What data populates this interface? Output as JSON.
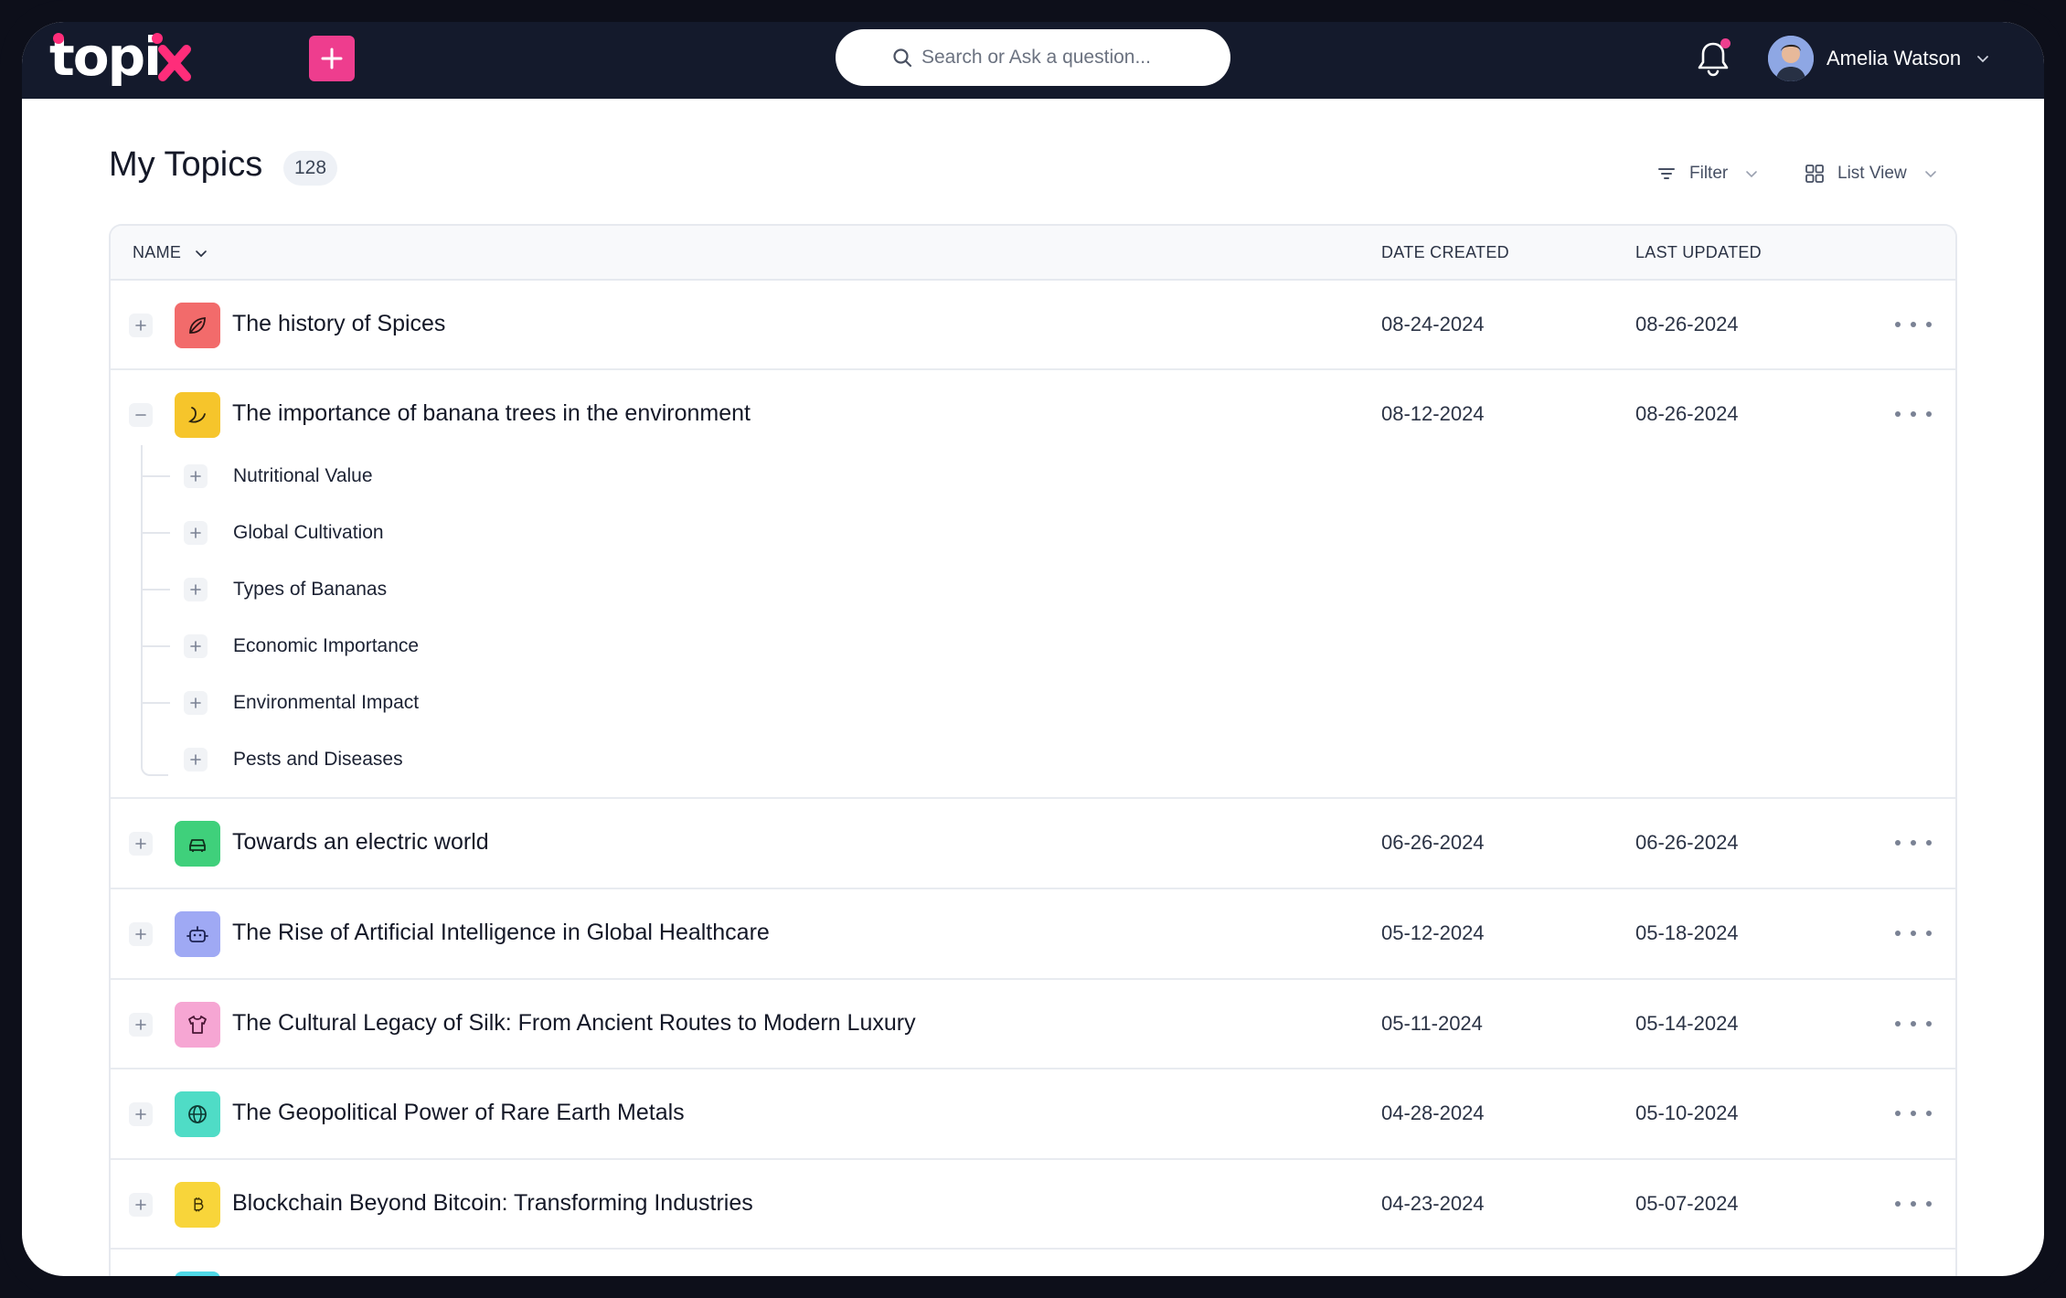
{
  "app": {
    "logo": "topix",
    "add_button_label": "+",
    "search_placeholder": "Search or Ask a question...",
    "user_name": "Amelia Watson"
  },
  "page": {
    "title": "My Topics",
    "count": "128",
    "filter_label": "Filter",
    "view_label": "List View"
  },
  "table": {
    "headers": {
      "name": "NAME",
      "created": "DATE CREATED",
      "updated": "LAST UPDATED"
    },
    "rows": [
      {
        "name": "The history of Spices",
        "created": "08-24-2024",
        "updated": "08-26-2024",
        "icon": "leaf-icon",
        "color": "#f26b6b",
        "expanded": false
      },
      {
        "name": "The importance of banana trees in the environment",
        "created": "08-12-2024",
        "updated": "08-26-2024",
        "icon": "banana-icon",
        "color": "#f6c52b",
        "expanded": true,
        "subtopics": [
          "Nutritional Value",
          "Global Cultivation",
          "Types of Bananas",
          "Economic Importance",
          "Environmental Impact",
          "Pests and Diseases"
        ]
      },
      {
        "name": "Towards an electric world",
        "created": "06-26-2024",
        "updated": "06-26-2024",
        "icon": "car-icon",
        "color": "#3fd07b",
        "expanded": false
      },
      {
        "name": "The Rise of Artificial Intelligence in Global Healthcare",
        "created": "05-12-2024",
        "updated": "05-18-2024",
        "icon": "robot-icon",
        "color": "#9fa9f4",
        "expanded": false
      },
      {
        "name": "The Cultural Legacy of Silk: From Ancient Routes to Modern Luxury",
        "created": "05-11-2024",
        "updated": "05-14-2024",
        "icon": "shirt-icon",
        "color": "#f6a6d3",
        "expanded": false
      },
      {
        "name": "The Geopolitical Power of Rare Earth Metals",
        "created": "04-28-2024",
        "updated": "05-10-2024",
        "icon": "globe-icon",
        "color": "#4fdcc6",
        "expanded": false
      },
      {
        "name": "Blockchain Beyond Bitcoin: Transforming Industries",
        "created": "04-23-2024",
        "updated": "05-07-2024",
        "icon": "bitcoin-icon",
        "color": "#f8d53a",
        "expanded": false
      }
    ]
  }
}
